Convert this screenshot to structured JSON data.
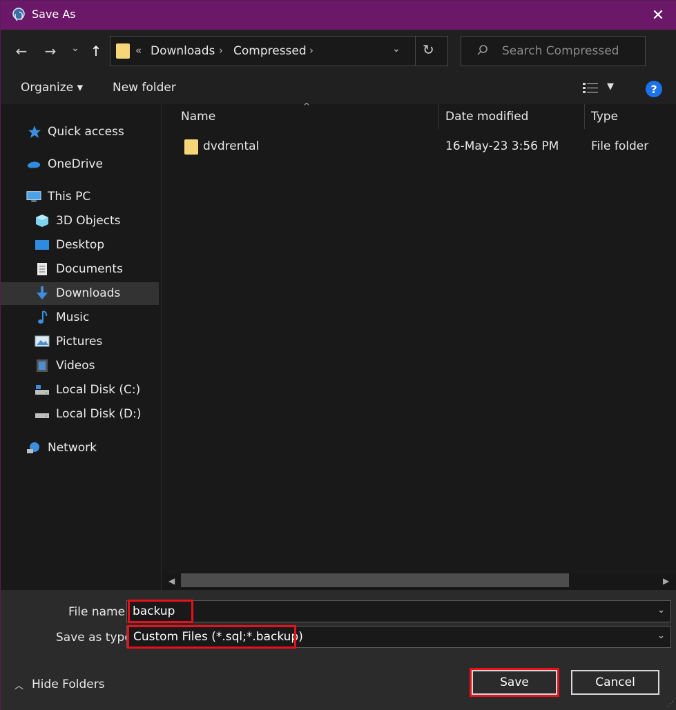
{
  "window": {
    "title": "Save As",
    "close_glyph": "✕"
  },
  "nav": {
    "back_glyph": "←",
    "forward_glyph": "→",
    "recent_glyph": "⌄",
    "up_glyph": "↑",
    "breadcrumb": {
      "overflow": "«",
      "items": [
        "Downloads",
        "Compressed"
      ],
      "sep": "›"
    },
    "refresh_glyph": "↻",
    "search_placeholder": "Search Compressed"
  },
  "toolbar": {
    "organize": "Organize ▾",
    "new_folder": "New folder",
    "help": "?"
  },
  "sidebar": {
    "items": [
      {
        "label": "Quick access",
        "icon": "star-icon"
      },
      {
        "label": "OneDrive",
        "icon": "cloud-icon"
      },
      {
        "label": "This PC",
        "icon": "monitor-icon"
      },
      {
        "label": "3D Objects",
        "icon": "cube-icon"
      },
      {
        "label": "Desktop",
        "icon": "desktop-icon"
      },
      {
        "label": "Documents",
        "icon": "document-icon"
      },
      {
        "label": "Downloads",
        "icon": "download-arrow-icon",
        "selected": true
      },
      {
        "label": "Music",
        "icon": "music-note-icon"
      },
      {
        "label": "Pictures",
        "icon": "picture-icon"
      },
      {
        "label": "Videos",
        "icon": "film-icon"
      },
      {
        "label": "Local Disk (C:)",
        "icon": "drive-icon"
      },
      {
        "label": "Local Disk (D:)",
        "icon": "drive-icon"
      },
      {
        "label": "Network",
        "icon": "network-icon"
      }
    ]
  },
  "filelist": {
    "columns": [
      "Name",
      "Date modified",
      "Type"
    ],
    "rows": [
      {
        "name": "dvdrental",
        "date": "16-May-23 3:56 PM",
        "type": "File folder"
      }
    ]
  },
  "form": {
    "file_name_label": "File name:",
    "file_name_value": "backup",
    "save_type_label": "Save as type:",
    "save_type_value": "Custom Files (*.sql;*.backup)"
  },
  "footer": {
    "hide_folders": "Hide Folders",
    "save": "Save",
    "cancel": "Cancel"
  },
  "colors": {
    "titlebar": "#6b1868",
    "highlight": "#e8101a",
    "folder": "#f7d67a",
    "help": "#1a73e8"
  }
}
